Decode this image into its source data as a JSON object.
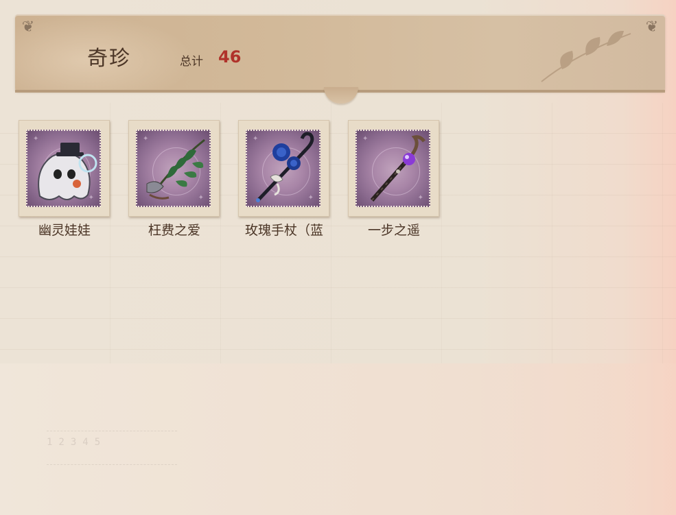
{
  "header": {
    "title": "奇珍",
    "total_label": "总计",
    "total_value": "46"
  },
  "items": [
    {
      "label": "幽灵娃娃",
      "icon": "ghost-doll-icon"
    },
    {
      "label": "枉费之爱",
      "icon": "feather-quill-icon"
    },
    {
      "label": "玫瑰手杖（蓝",
      "icon": "blue-rose-cane-icon"
    },
    {
      "label": "一步之遥",
      "icon": "crystal-staff-icon"
    }
  ],
  "colors": {
    "header_bg": "#d2b999",
    "stamp_purple": "#a885a7",
    "total_value": "#b0322a",
    "text_brown": "#4b3526"
  }
}
